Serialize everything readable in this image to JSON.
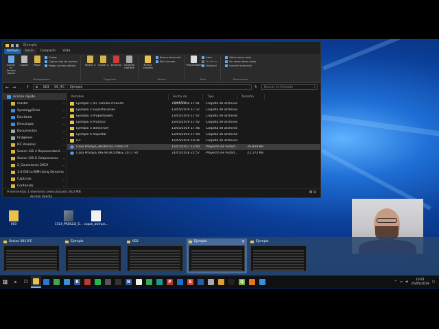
{
  "window": {
    "title": "Ejemplo",
    "menu_tabs": [
      "Archivo",
      "Inicio",
      "Compartir",
      "Vista"
    ],
    "ribbon": {
      "portapapeles": {
        "label": "Portapapeles",
        "anclar": "Anclar al Acceso rápido",
        "copiar": "Copiar",
        "pegar": "Pegar",
        "cortar": "Cortar",
        "copiar_ruta": "Copiar ruta de acceso",
        "pegar_acceso": "Pegar acceso directo"
      },
      "organizar": {
        "label": "Organizar",
        "mover": "Mover a",
        "copiar": "Copiar a",
        "eliminar": "Eliminar",
        "cambiar": "Cambiar nombre"
      },
      "nuevo": {
        "label": "Nuevo",
        "nueva_carpeta": "Nueva carpeta",
        "nuevo_elemento": "Nuevo elemento",
        "facil_acceso": "Fácil acceso"
      },
      "abrir": {
        "label": "Abrir",
        "propiedades": "Propiedades",
        "abrir": "Abrir",
        "modificar": "Modificar",
        "historial": "Historial"
      },
      "seleccionar": {
        "label": "Seleccionar",
        "todo": "Seleccionar todo",
        "nada": "No seleccionar nada",
        "invertir": "Invertir selección"
      }
    },
    "path": [
      "003",
      "00_IFC",
      "Ejemplo"
    ],
    "search_placeholder": "Buscar en Ejemplo",
    "nav_items": [
      {
        "label": "Acceso rápido",
        "color": "#4a9be8",
        "head": true
      },
      {
        "label": "master",
        "color": "#d8b54a"
      },
      {
        "label": "SynologyDrive",
        "color": "#3a8fd8"
      },
      {
        "label": "Escritorio",
        "color": "#3a8fd8"
      },
      {
        "label": "Descargas",
        "color": "#3a8fd8"
      },
      {
        "label": "Documentos",
        "color": "#9aa"
      },
      {
        "label": "Imágenes",
        "color": "#9aa"
      },
      {
        "label": "IFC Analizer",
        "color": "#d8b54a"
      },
      {
        "label": "Sesion GIS 4 Representació",
        "color": "#d8b54a"
      },
      {
        "label": "Sesion GIS 6 Geoprocesos",
        "color": "#d8b54a"
      },
      {
        "label": "2_Conexiones 2019",
        "color": "#d8b54a"
      },
      {
        "label": "1.4 GIS to BIM Using Dynamo",
        "color": "#d8b54a"
      },
      {
        "label": "Capturas",
        "color": "#d8b54a"
      },
      {
        "label": "Contenido",
        "color": "#d8b54a"
      }
    ],
    "columns": [
      "Nombre",
      "Fecha de modifica...",
      "Tipo",
      "Tamaño"
    ],
    "files": [
      {
        "name": "Ejemplo 1 IFC Familia creando",
        "date": "13/05/2019 17:41",
        "type": "Carpeta de archivos",
        "size": "",
        "kind": "folder"
      },
      {
        "name": "Ejemplo 2 Exportaciones",
        "date": "13/05/2019 17:37",
        "type": "Carpeta de archivos",
        "size": "",
        "kind": "folder"
      },
      {
        "name": "Ejemplo 3 PropertySets",
        "date": "13/05/2019 17:47",
        "type": "Carpeta de archivos",
        "size": "",
        "kind": "folder"
      },
      {
        "name": "Ejemplo 4 Practico",
        "date": "13/05/2019 17:42",
        "type": "Carpeta de archivos",
        "size": "",
        "kind": "folder"
      },
      {
        "name": "Ejemplo 5 Bimserver",
        "date": "13/05/2019 17:46",
        "type": "Carpeta de archivos",
        "size": "",
        "kind": "folder"
      },
      {
        "name": "Ejemplo 6 Importar",
        "date": "13/05/2019 17:49",
        "type": "Carpeta de archivos",
        "size": "",
        "kind": "folder"
      },
      {
        "name": "IFC",
        "date": "15/05/2019 19:36",
        "type": "Carpeta de archivos",
        "size": "",
        "kind": "folder"
      },
      {
        "name": "Casa Pralaya_ARQUITECTURA.rvt",
        "date": "15/07/2017 13:40",
        "type": "Proyecto de Autod...",
        "size": "26.824 KB",
        "kind": "rvt",
        "selected": true
      },
      {
        "name": "Casa Pralaya_INSTALACIONES_2017.rvt",
        "date": "31/05/2018 22:57",
        "type": "Proyecto de Autod...",
        "size": "22.172 KB",
        "kind": "rvt"
      }
    ],
    "status": "9 elementos   1 elemento seleccionado  26,0 MB"
  },
  "desktop": {
    "behind_label": "Acceso directo",
    "icons": [
      {
        "label": "003",
        "kind": "folder"
      },
      {
        "label": "1514_PASILLO_S...",
        "kind": "image"
      },
      {
        "label": "capas_asimun...",
        "kind": "doc"
      }
    ]
  },
  "task_view": [
    {
      "title": "Sesion 001 IFC",
      "active": false
    },
    {
      "title": "Ejemplo",
      "active": false
    },
    {
      "title": "002",
      "active": false
    },
    {
      "title": "Ejemplo",
      "active": true
    },
    {
      "title": "Ejemplo",
      "active": false
    }
  ],
  "taskbar": {
    "apps": [
      {
        "name": "explorer",
        "color": "#e8c24a",
        "glyph": "",
        "active": true
      },
      {
        "name": "mail",
        "color": "#2b78d0",
        "glyph": ""
      },
      {
        "name": "chrome",
        "color": "#3aa757",
        "glyph": ""
      },
      {
        "name": "edge",
        "color": "#3a8fd8",
        "glyph": ""
      },
      {
        "name": "revit",
        "color": "#2a5ca8",
        "glyph": "R"
      },
      {
        "name": "app-red",
        "color": "#c0392b",
        "glyph": ""
      },
      {
        "name": "spotify",
        "color": "#1db954",
        "glyph": ""
      },
      {
        "name": "media",
        "color": "#555",
        "glyph": ""
      },
      {
        "name": "app-dark",
        "color": "#333",
        "glyph": ""
      },
      {
        "name": "navisworks",
        "color": "#2a5ca8",
        "glyph": "N"
      },
      {
        "name": "app-white",
        "color": "#eee",
        "glyph": ""
      },
      {
        "name": "green-app",
        "color": "#3aa757",
        "glyph": ""
      },
      {
        "name": "teal-app",
        "color": "#1a9b8a",
        "glyph": ""
      },
      {
        "name": "powerpoint",
        "color": "#c0392b",
        "glyph": "P"
      },
      {
        "name": "code",
        "color": "#1a6fd0",
        "glyph": ""
      },
      {
        "name": "red-app",
        "color": "#d04a3a",
        "glyph": "S"
      },
      {
        "name": "blue-app",
        "color": "#2b5ca8",
        "glyph": ""
      },
      {
        "name": "arrow-app",
        "color": "#aaa",
        "glyph": ""
      },
      {
        "name": "chrome2",
        "color": "#e0a030",
        "glyph": ""
      },
      {
        "name": "obs",
        "color": "#222",
        "glyph": ""
      },
      {
        "name": "qgis",
        "color": "#7bb03a",
        "glyph": "Q"
      },
      {
        "name": "firefox",
        "color": "#e8741c",
        "glyph": ""
      },
      {
        "name": "terminal",
        "color": "#3a8fd8",
        "glyph": ""
      }
    ],
    "time": "10:41",
    "date": "25/05/2019"
  }
}
